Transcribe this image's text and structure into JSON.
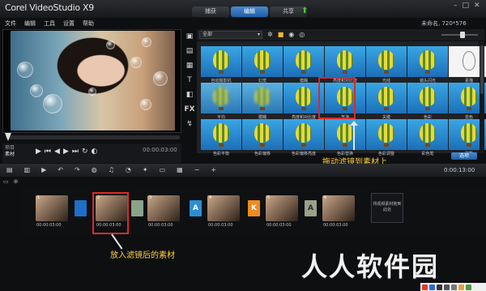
{
  "app": {
    "logo": "Corel VideoStudio X9"
  },
  "menu": [
    "文件",
    "编辑",
    "工具",
    "设置",
    "帮助"
  ],
  "step_tabs": [
    {
      "label": "捕获",
      "active": false
    },
    {
      "label": "编辑",
      "active": true
    },
    {
      "label": "共享",
      "active": false
    }
  ],
  "project": {
    "info": "未命名, 720*576"
  },
  "player": {
    "mode_project": "项目",
    "mode_clip": "素材",
    "timecode": "00:00:03:00",
    "buttons": [
      "play-icon",
      "home-icon",
      "prev-frame-icon",
      "next-frame-icon",
      "end-icon",
      "repeat-icon",
      "volume-icon"
    ]
  },
  "library": {
    "filter_value": "全部",
    "thumbnails": [
      {
        "caption": "自动摄影机",
        "style": "blue"
      },
      {
        "caption": "幻觉",
        "style": "blue"
      },
      {
        "caption": "模糊",
        "style": "blue"
      },
      {
        "caption": "亮度和对比度",
        "style": "blue"
      },
      {
        "caption": "光线",
        "style": "blue"
      },
      {
        "caption": "镜头闪光",
        "style": "blue"
      },
      {
        "caption": "素描",
        "style": "white"
      },
      {
        "caption": "平均",
        "style": "blur"
      },
      {
        "caption": "模糊",
        "style": "blur"
      },
      {
        "caption": "亮度和对比度",
        "style": "blue"
      },
      {
        "caption": "气泡",
        "style": "blue"
      },
      {
        "caption": "关键",
        "style": "blue"
      },
      {
        "caption": "色彩",
        "style": "blue"
      },
      {
        "caption": "去色",
        "style": "blue"
      },
      {
        "caption": "色彩平衡",
        "style": "blue"
      },
      {
        "caption": "色彩偏移",
        "style": "blue"
      },
      {
        "caption": "色彩偏移亮度",
        "style": "blue"
      },
      {
        "caption": "色彩替换",
        "style": "blue"
      },
      {
        "caption": "色彩调整",
        "style": "blue"
      },
      {
        "caption": "彩色笔",
        "style": "blue"
      },
      {
        "caption": "炭笔",
        "style": "blue"
      }
    ],
    "options_button": "选项"
  },
  "annotations": {
    "drag_filter": "拖动滤镜到素材上",
    "after_filter": "放入滤镜后的素材"
  },
  "timeline": {
    "timecode": "0:00:13:00",
    "clips": [
      {
        "num": "1",
        "time": "00:00:03:00"
      },
      {
        "num": "2",
        "time": "00:00:03:00"
      },
      {
        "num": "3",
        "time": "00:00:03:00"
      },
      {
        "num": "4",
        "time": "00:00:03:00"
      },
      {
        "num": "5",
        "time": "00:00:03:00"
      },
      {
        "num": "6",
        "time": "00:00:03:00"
      }
    ],
    "transitions": [
      {
        "glyph": "",
        "color": "#f5b338",
        "bg": "#1e6fc8"
      },
      {
        "glyph": "",
        "color": "#ffffff",
        "bg": "#8aa38a"
      },
      {
        "glyph": "A",
        "color": "#ffffff",
        "bg": "#2a8fd8"
      },
      {
        "glyph": "K",
        "color": "#ffffff",
        "bg": "#f08a1e"
      },
      {
        "glyph": "A",
        "color": "#2a2a2a",
        "bg": "#9aa08a"
      }
    ],
    "drop_text": "将视频素材拖到此处"
  },
  "watermark": "人人软件园"
}
